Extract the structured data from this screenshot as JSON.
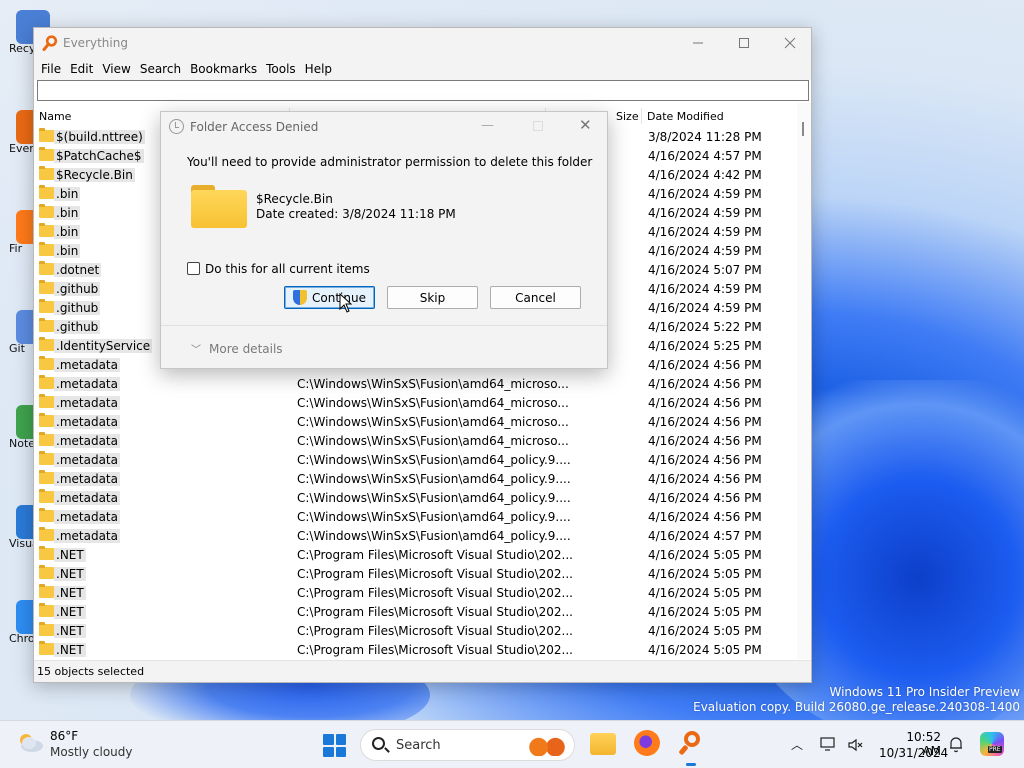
{
  "desktop": {
    "icons": [
      {
        "label": "Recy",
        "color": "#4a7fd6"
      },
      {
        "label": "Ever",
        "color": "#ea6a14"
      },
      {
        "label": "Fir",
        "color": "#ff7a1a"
      },
      {
        "label": "Git",
        "color": "#5c8be0"
      },
      {
        "label": "Note",
        "color": "#3fa34d"
      },
      {
        "label": "Visua",
        "color": "#2a7ad8"
      },
      {
        "label": "Chro",
        "color": "#2e8df2"
      }
    ],
    "watermark_line1": "Windows 11 Pro Insider Preview",
    "watermark_line2": "Evaluation copy. Build 26080.ge_release.240308-1400"
  },
  "window": {
    "title": "Everything",
    "menu": [
      "File",
      "Edit",
      "View",
      "Search",
      "Bookmarks",
      "Tools",
      "Help"
    ],
    "search_value": "",
    "columns": {
      "name": "Name",
      "size": "Size",
      "date": "Date Modified"
    },
    "rows": [
      {
        "name": "$(build.nttree)",
        "path": "",
        "date": "3/8/2024 11:28 PM"
      },
      {
        "name": "$PatchCache$",
        "path": "",
        "date": "4/16/2024 4:57 PM"
      },
      {
        "name": "$Recycle.Bin",
        "path": "",
        "date": "4/16/2024 4:42 PM"
      },
      {
        "name": ".bin",
        "path": "",
        "date": "4/16/2024 4:59 PM"
      },
      {
        "name": ".bin",
        "path": "",
        "date": "4/16/2024 4:59 PM"
      },
      {
        "name": ".bin",
        "path": "",
        "date": "4/16/2024 4:59 PM"
      },
      {
        "name": ".bin",
        "path": "",
        "date": "4/16/2024 4:59 PM"
      },
      {
        "name": ".dotnet",
        "path": "",
        "date": "4/16/2024 5:07 PM"
      },
      {
        "name": ".github",
        "path": "",
        "date": "4/16/2024 4:59 PM"
      },
      {
        "name": ".github",
        "path": "",
        "date": "4/16/2024 4:59 PM"
      },
      {
        "name": ".github",
        "path": "",
        "date": "4/16/2024 5:22 PM"
      },
      {
        "name": ".IdentityService",
        "path": "",
        "date": "4/16/2024 5:25 PM"
      },
      {
        "name": ".metadata",
        "path": "",
        "date": "4/16/2024 4:56 PM"
      },
      {
        "name": ".metadata",
        "path": "C:\\Windows\\WinSxS\\Fusion\\amd64_microso...",
        "date": "4/16/2024 4:56 PM"
      },
      {
        "name": ".metadata",
        "path": "C:\\Windows\\WinSxS\\Fusion\\amd64_microso...",
        "date": "4/16/2024 4:56 PM"
      },
      {
        "name": ".metadata",
        "path": "C:\\Windows\\WinSxS\\Fusion\\amd64_microso...",
        "date": "4/16/2024 4:56 PM"
      },
      {
        "name": ".metadata",
        "path": "C:\\Windows\\WinSxS\\Fusion\\amd64_microso...",
        "date": "4/16/2024 4:56 PM"
      },
      {
        "name": ".metadata",
        "path": "C:\\Windows\\WinSxS\\Fusion\\amd64_policy.9....",
        "date": "4/16/2024 4:56 PM"
      },
      {
        "name": ".metadata",
        "path": "C:\\Windows\\WinSxS\\Fusion\\amd64_policy.9....",
        "date": "4/16/2024 4:56 PM"
      },
      {
        "name": ".metadata",
        "path": "C:\\Windows\\WinSxS\\Fusion\\amd64_policy.9....",
        "date": "4/16/2024 4:56 PM"
      },
      {
        "name": ".metadata",
        "path": "C:\\Windows\\WinSxS\\Fusion\\amd64_policy.9....",
        "date": "4/16/2024 4:56 PM"
      },
      {
        "name": ".metadata",
        "path": "C:\\Windows\\WinSxS\\Fusion\\amd64_policy.9....",
        "date": "4/16/2024 4:57 PM"
      },
      {
        "name": ".NET",
        "path": "C:\\Program Files\\Microsoft Visual Studio\\202...",
        "date": "4/16/2024 5:05 PM"
      },
      {
        "name": ".NET",
        "path": "C:\\Program Files\\Microsoft Visual Studio\\202...",
        "date": "4/16/2024 5:05 PM"
      },
      {
        "name": ".NET",
        "path": "C:\\Program Files\\Microsoft Visual Studio\\202...",
        "date": "4/16/2024 5:05 PM"
      },
      {
        "name": ".NET",
        "path": "C:\\Program Files\\Microsoft Visual Studio\\202...",
        "date": "4/16/2024 5:05 PM"
      },
      {
        "name": ".NET",
        "path": "C:\\Program Files\\Microsoft Visual Studio\\202...",
        "date": "4/16/2024 5:05 PM"
      },
      {
        "name": ".NET",
        "path": "C:\\Program Files\\Microsoft Visual Studio\\202...",
        "date": "4/16/2024 5:05 PM"
      }
    ],
    "status": "15 objects selected"
  },
  "dialog": {
    "title": "Folder Access Denied",
    "message": "You'll need to provide administrator permission to delete this folder",
    "folder_name": "$Recycle.Bin",
    "folder_date": "Date created: 3/8/2024 11:18 PM",
    "checkbox_label": "Do this for all current items",
    "checkbox_checked": false,
    "continue_label": "Continue",
    "skip_label": "Skip",
    "cancel_label": "Cancel",
    "more_details": "More details"
  },
  "taskbar": {
    "temp": "86°F",
    "condition": "Mostly cloudy",
    "search_label": "Search",
    "time": "10:52 AM",
    "date": "10/31/2024",
    "copilot_badge": "PRE"
  }
}
